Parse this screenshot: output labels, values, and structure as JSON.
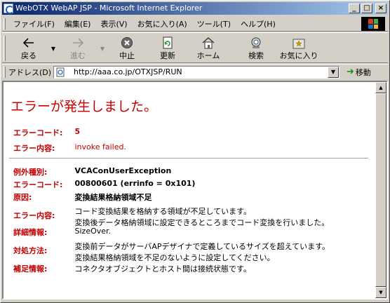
{
  "window": {
    "title": "WebOTX WebAP JSP - Microsoft Internet Explorer",
    "minimize": "_",
    "maximize": "□",
    "close": "×"
  },
  "menu": [
    "ファイル(F)",
    "編集(E)",
    "表示(V)",
    "お気に入り(A)",
    "ツール(T)",
    "ヘルプ(H)"
  ],
  "toolbar": {
    "back": "戻る",
    "forward": "進む",
    "stop": "中止",
    "refresh": "更新",
    "home": "ホーム",
    "search": "検索",
    "favorites": "お気に入り"
  },
  "address": {
    "label": "アドレス(D)",
    "url": "http://aaa.co.jp/OTXJSP/RUN",
    "go": "移動"
  },
  "page": {
    "heading": "エラーが発生しました。",
    "summary": {
      "code_label": "エラーコード:",
      "code_value": "5",
      "content_label": "エラー内容:",
      "content_value": "invoke failed."
    },
    "detail": {
      "exception_label": "例外種別:",
      "exception_value": "VCAConUserException",
      "code_label": "エラーコード:",
      "code_value": "00800601 (errinfo = 0x101)",
      "cause_label": "原因:",
      "cause_value": "変換結果格納領域不足",
      "content_label": "エラー内容:",
      "content_line1": "コード変換結果を格納する領域が不足しています。",
      "content_line2": "変換後データ格納領域に設定できるところまでコード変換を行いました。",
      "info_label": "詳細情報:",
      "info_value": "SizeOver.",
      "action_label": "対処方法:",
      "action_line1": "変換前データがサーバAPデザイナで定義しているサイズを超えています。",
      "action_line2": "変換結果格納領域を不足のないように設定してください。",
      "supp_label": "補足情報:",
      "supp_value": "コネクタオブジェクトとホスト間は接続状態です。"
    }
  },
  "colors": {
    "error_red": "#c00000",
    "titlebar_start": "#0a246a",
    "titlebar_end": "#a6caf0",
    "chrome": "#d4d0c8"
  }
}
